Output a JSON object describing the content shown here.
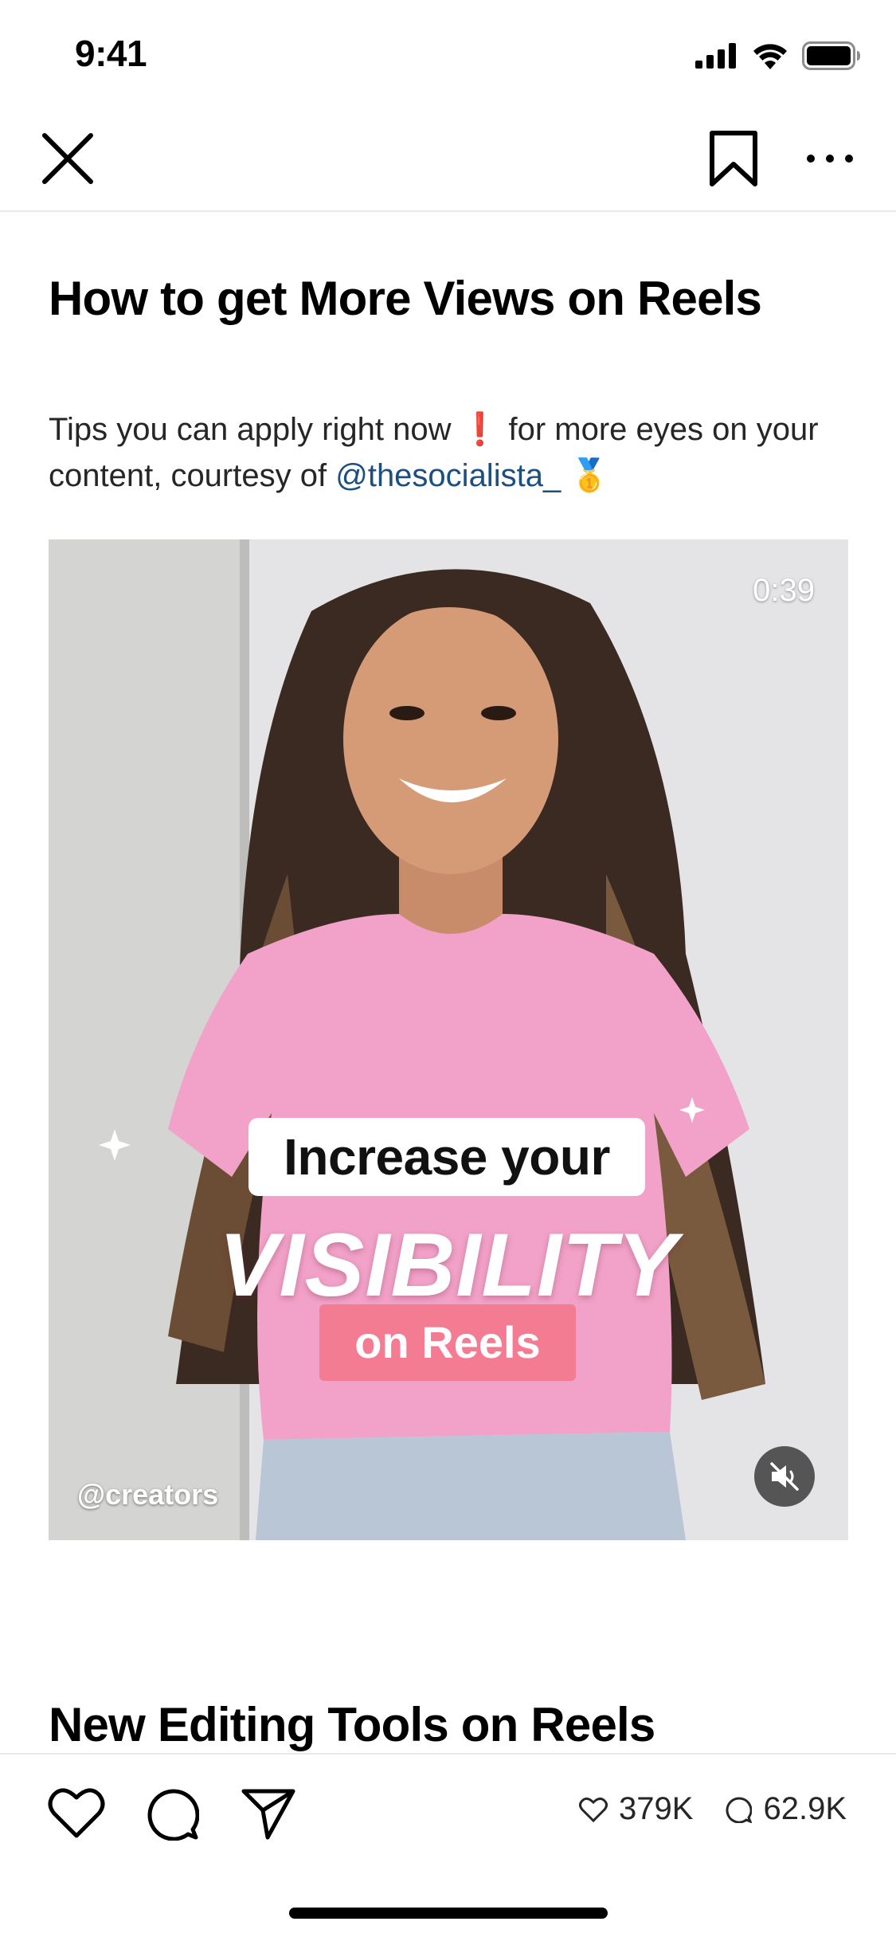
{
  "status_bar": {
    "time": "9:41"
  },
  "nav": {
    "close_icon": "close-icon",
    "bookmark_icon": "bookmark-icon",
    "more_icon": "more-horizontal-icon"
  },
  "article": {
    "title": "How to get More Views on Reels",
    "subtitle_text": "Tips you can apply right now ❗ for more eyes on your content, courtesy of",
    "subtitle_mention": "@thesocialista_",
    "subtitle_emoji": "🥇"
  },
  "video": {
    "duration": "0:39",
    "author": "@creators",
    "overlay_line1": "Increase your",
    "overlay_line2": "VISIBILITY",
    "overlay_line3": "on Reels",
    "muted": true
  },
  "next_section": {
    "title": "New Editing Tools on Reels"
  },
  "actions": {
    "likes": "379K",
    "comments": "62.9K"
  },
  "colors": {
    "mention": "#1c4e80",
    "overlay_pink": "#f47c92",
    "shirt_pink": "#f2a2c8"
  }
}
